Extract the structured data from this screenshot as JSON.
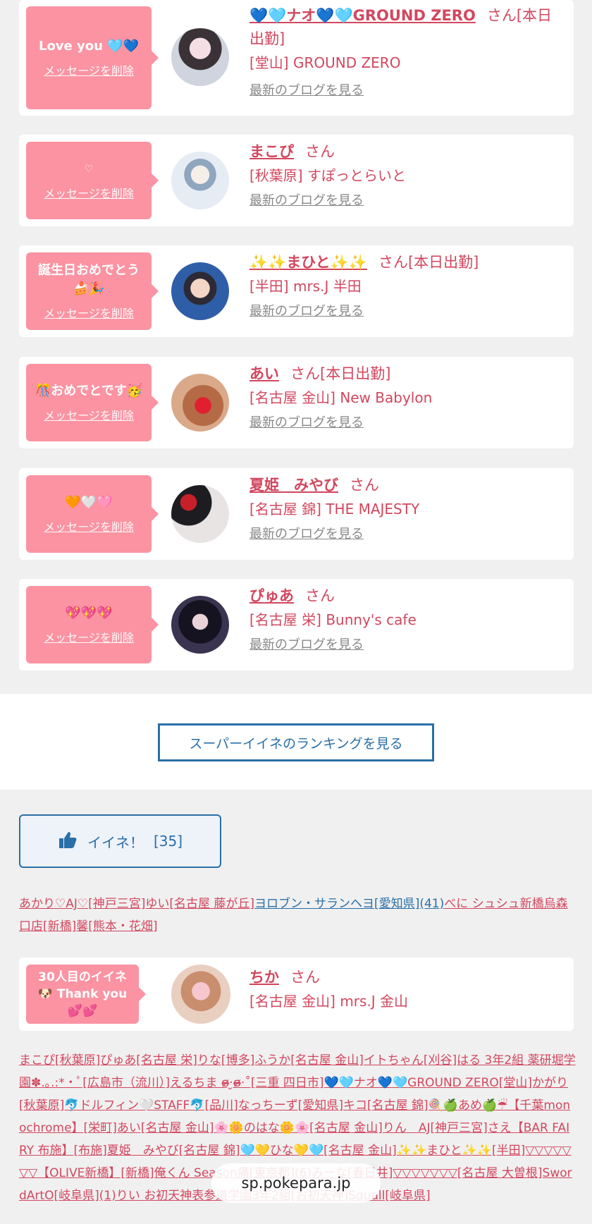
{
  "cards": [
    {
      "bubble": "Love you 🩵💙",
      "delete": "メッセージを削除",
      "name": "💙🩵ナオ💙🩵GROUND ZERO",
      "san": "さん[本日出勤]",
      "shop": "[堂山] GROUND ZERO",
      "blog": "最新のブログを見る"
    },
    {
      "bubble": "♡",
      "delete": "メッセージを削除",
      "name": "まこぴ",
      "san": "さん",
      "shop": "[秋葉原] すぽっとらいと",
      "blog": "最新のブログを見る"
    },
    {
      "bubble": "誕生日おめでとう🍰🎉",
      "delete": "メッセージを削除",
      "name": "✨✨まひと✨✨",
      "san": "さん[本日出勤]",
      "shop": "[半田] mrs.J 半田",
      "blog": "最新のブログを見る"
    },
    {
      "bubble": "🎊おめでとです🥳",
      "delete": "メッセージを削除",
      "name": "あい",
      "san": "さん[本日出勤]",
      "shop": "[名古屋 金山] New Babylon",
      "blog": "最新のブログを見る"
    },
    {
      "bubble": "🧡🤍🩷",
      "delete": "メッセージを削除",
      "name": "夏姫　みやび",
      "san": "さん",
      "shop": "[名古屋 錦] THE MAJESTY",
      "blog": "最新のブログを見る"
    },
    {
      "bubble": "💖💖💖",
      "delete": "メッセージを削除",
      "name": "ぴゅあ",
      "san": "さん",
      "shop": "[名古屋 栄] Bunny's cafe",
      "blog": "最新のブログを見る"
    }
  ],
  "ranking_button": "スーパーイイネのランキングを見る",
  "iine": {
    "label": "イイネ！",
    "count": "[35]"
  },
  "likers_1": [
    {
      "text": "あかり♡AJ♡[神戸三宮]",
      "color": "pink"
    },
    {
      "text": "ゆい[名古屋 藤が丘]",
      "color": "pink"
    },
    {
      "text": "ヨロブン・サランヘヨ[愛知県](41)",
      "color": "blue"
    },
    {
      "text": "べに シュシュ新橋烏森口店[新橋]",
      "color": "pink"
    },
    {
      "text": "馨[熊本・花畑]",
      "color": "pink"
    }
  ],
  "chika": {
    "bubble": "30人目のイイネ🐶 Thank you💕💕",
    "name": "ちか",
    "san": "さん",
    "shop": "[名古屋 金山] mrs.J 金山"
  },
  "likers_2": "まこぴ[秋葉原]ぴゅあ[名古屋 栄]りな[博多]ふうか[名古屋 金山]イトちゃん[刈谷]はる 3年2組 薬研堀学園✽.｡.:*・ﾟ[広島市（流川）]えるちま ɞ̴̶̷·̮ɞ̴̶̷‧˚[三重 四日市]💙🩵ナオ💙🩵GROUND ZERO[堂山]かがり[秋葉原]🐬ドルフィン🤍STAFF🐬[品川]なっちーず[愛知県]キコ[名古屋 錦]🍭🍏あめ🍏☔【千葉monochrome】[栄町]あい[名古屋 金山]🌸🌼のはな🌼🌸[名古屋 金山]りん　AJ[神戸三宮]さえ【BAR FAIRY 布施】[布施]夏姫　みやび[名古屋 錦]🩵💛ひな💛🩵[名古屋 金山]✨✨まひと✨✨[半田]▽▽▽▽▽▽▽【OLIVE新橋】[新橋]俺くん Season痛[東京都](6)みーな[春日井]▽▽▽▽▽▽▽[名古屋 大曽根]SwordArtO[岐阜県](1)りい お初天神表参道学園3年2組[お初天神]Squall[岐阜県]",
  "url": "sp.pokepara.jp",
  "colors": {
    "pink": "#d2475e",
    "bubble": "#fb93a2",
    "blue": "#2a6fa8"
  }
}
